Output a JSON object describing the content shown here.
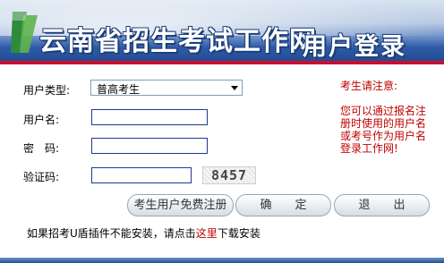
{
  "header": {
    "site_title": "云南省招生考试工作网",
    "page_title": "用户登录"
  },
  "form": {
    "user_type_label": "用户类型:",
    "user_type_selected": "普高考生",
    "username_label": "用户名:",
    "username_value": "",
    "password_label": "密　码:",
    "password_value": "",
    "captcha_label": "验证码:",
    "captcha_value": "",
    "captcha_image_text": "8457"
  },
  "buttons": {
    "register": "考生用户免费注册",
    "confirm": "确　　定",
    "exit": "退　　出"
  },
  "notice": {
    "title": "考生请注意:",
    "body": "您可以通过报名注册时使用的用户名或考号作为用户名登录工作网!"
  },
  "footer": {
    "text_before": "如果招考U盾插件不能安装，请点击",
    "link_text": "这里",
    "text_after": "下载安装"
  },
  "colors": {
    "banner_dark": "#244c93",
    "accent_red": "#c8102e",
    "notice_red": "#c00000",
    "input_border": "#1f3a93"
  }
}
